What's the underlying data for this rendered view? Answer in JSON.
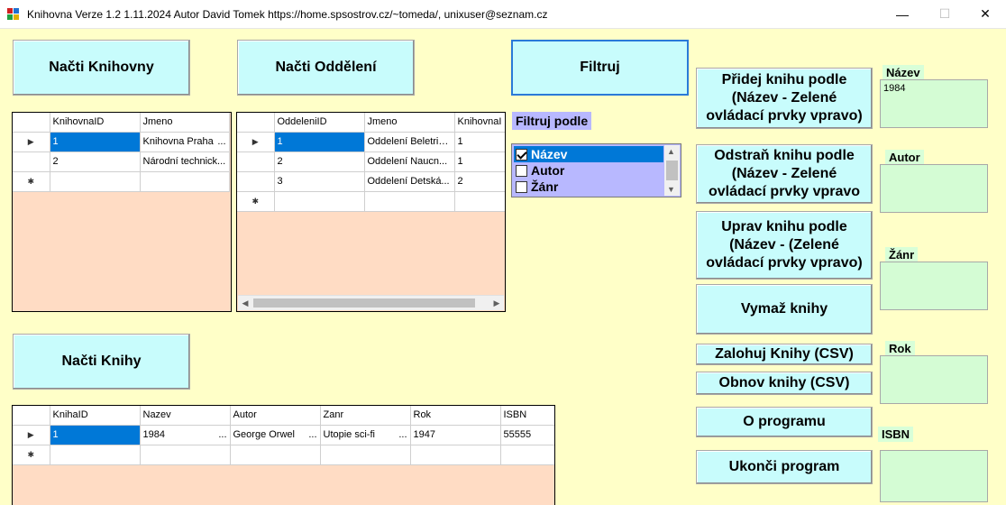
{
  "window": {
    "title": "Knihovna Verze 1.2 1.11.2024 Autor David Tomek https://home.spsostrov.cz/~tomeda/, unixuser@seznam.cz",
    "minimize": "—",
    "maximize": "☐",
    "close": "✕"
  },
  "buttons": {
    "nacti_knihovny": "Načti Knihovny",
    "nacti_oddeleni": "Načti Oddělení",
    "filtruj": "Filtruj",
    "nacti_knihy": "Načti Knihy",
    "pridej": "Přidej knihu podle (Název - Zelené ovládací prvky vpravo)",
    "odstran": "Odstraň knihu podle (Název - Zelené ovládací prvky  vpravo",
    "uprav": "Uprav knihu podle (Název - (Zelené ovládací prvky vpravo)",
    "vymaz": "Vymaž knihy",
    "zalohuj": "Zalohuj Knihy (CSV)",
    "obnov": "Obnov knihy  (CSV)",
    "o_programu": "O programu",
    "ukonci": "Ukonči program"
  },
  "filter": {
    "label": "Filtruj podle",
    "items": [
      {
        "label": "Název",
        "checked": true,
        "selected": true
      },
      {
        "label": "Autor",
        "checked": false,
        "selected": false
      },
      {
        "label": "Žánr",
        "checked": false,
        "selected": false
      }
    ]
  },
  "fields": {
    "nazev_label": "Název",
    "nazev_value": "1984",
    "autor_label": "Autor",
    "autor_value": "",
    "zanr_label": "Žánr",
    "zanr_value": "",
    "rok_label": "Rok",
    "rok_value": "",
    "isbn_label": "ISBN",
    "isbn_value": ""
  },
  "knihovny_grid": {
    "headers": [
      "KnihovnaID",
      "Jmeno"
    ],
    "rows": [
      [
        "1",
        "Knihovna Praha"
      ],
      [
        "2",
        "Národní technick..."
      ]
    ]
  },
  "oddeleni_grid": {
    "headers": [
      "OddeleniID",
      "Jmeno",
      "KnihovnaI"
    ],
    "rows": [
      [
        "1",
        "Oddelení Beletrie...",
        "1"
      ],
      [
        "2",
        "Oddelení Naucn...",
        "1"
      ],
      [
        "3",
        "Oddelení Detská...",
        "2"
      ]
    ]
  },
  "knihy_grid": {
    "headers": [
      "KnihaID",
      "Nazev",
      "Autor",
      "Zanr",
      "Rok",
      "ISBN"
    ],
    "rows": [
      [
        "1",
        "1984",
        "George Orwel",
        "Utopie sci-fi",
        "1947",
        "55555"
      ]
    ]
  }
}
